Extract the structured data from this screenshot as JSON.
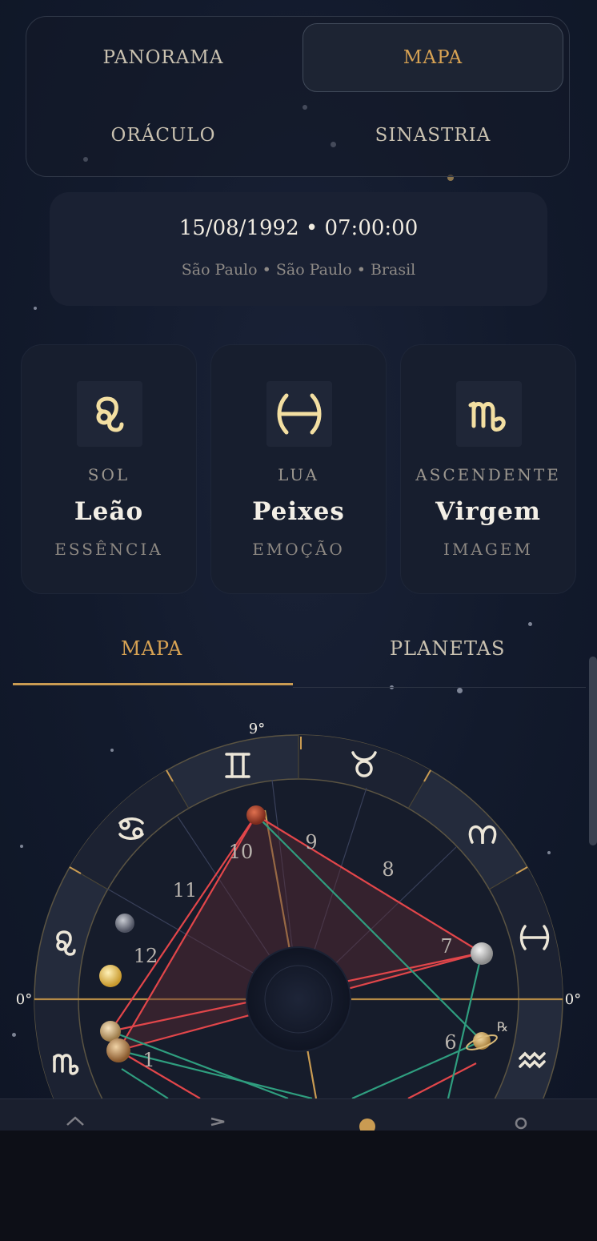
{
  "top_nav": {
    "items": [
      {
        "label": "PANORAMA",
        "active": false
      },
      {
        "label": "MAPA",
        "active": true
      },
      {
        "label": "ORÁCULO",
        "active": false
      },
      {
        "label": "SINASTRIA",
        "active": false
      }
    ]
  },
  "birth": {
    "datetime": "15/08/1992 • 07:00:00",
    "location": "São Paulo • São Paulo • Brasil"
  },
  "cards": [
    {
      "kind": "SOL",
      "sign": "Leão",
      "sub": "ESSÊNCIA",
      "glyph": "leo-icon"
    },
    {
      "kind": "LUA",
      "sign": "Peixes",
      "sub": "EMOÇÃO",
      "glyph": "pisces-icon"
    },
    {
      "kind": "ASCENDENTE",
      "sign": "Virgem",
      "sub": "IMAGEM",
      "glyph": "virgo-icon"
    }
  ],
  "tabs": [
    {
      "label": "MAPA",
      "active": true
    },
    {
      "label": "PLANETAS",
      "active": false
    }
  ],
  "chart": {
    "top_degree": "9°",
    "left_degree": "0°",
    "right_degree": "0°",
    "houses": [
      "1",
      "6",
      "7",
      "8",
      "9",
      "10",
      "11",
      "12"
    ],
    "retrograde_mark": "℞",
    "signs_visible": [
      "gemini",
      "taurus",
      "aries",
      "pisces",
      "aquarius",
      "virgo",
      "leo",
      "cancer"
    ]
  },
  "colors": {
    "accent": "#d7a253",
    "background": "#131a2b",
    "aspect_red": "#e2464a",
    "aspect_green": "#2f9e7f"
  },
  "bottom_nav": {
    "icons": [
      "home-icon",
      "flag-icon",
      "chart-icon",
      "profile-icon"
    ]
  }
}
